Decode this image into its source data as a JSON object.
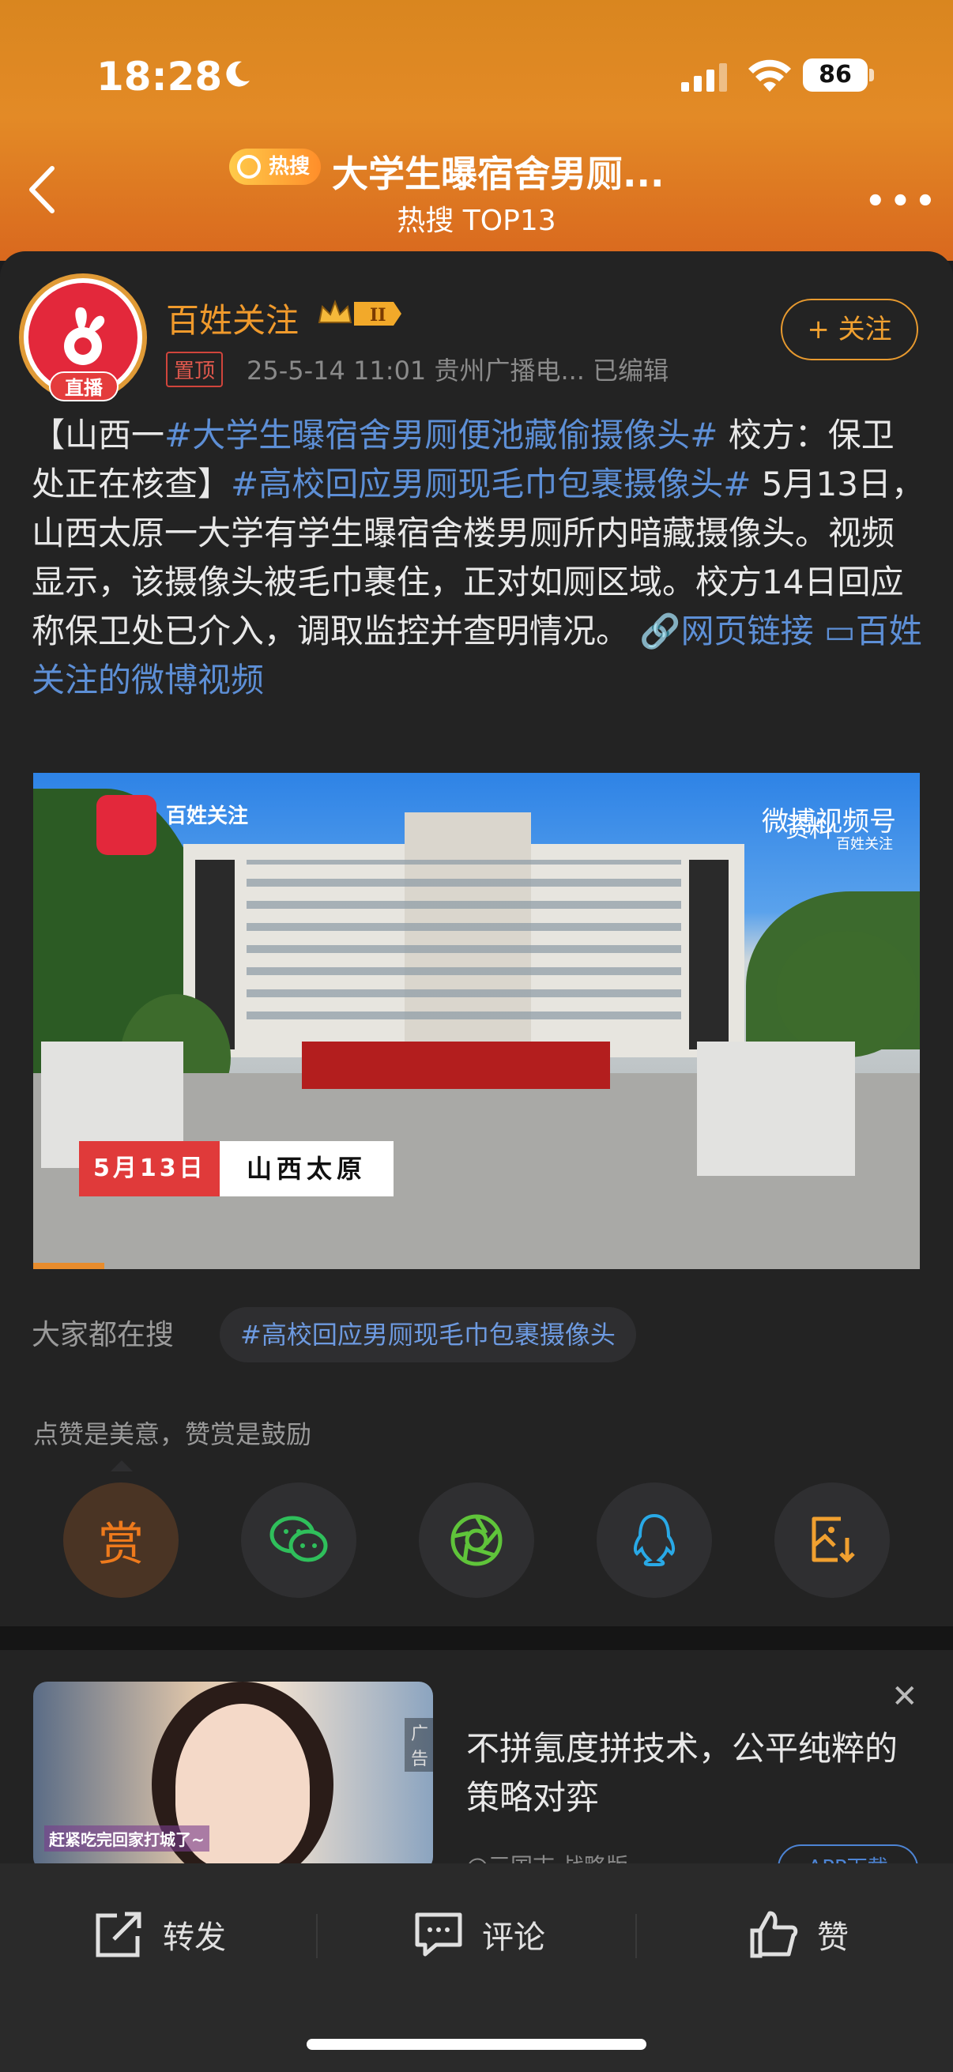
{
  "status_bar": {
    "time": "18:28",
    "battery": "86"
  },
  "header": {
    "hot_badge": "热搜",
    "title": "大学生曝宿舍男厕...",
    "subtitle": "热搜 TOP13"
  },
  "post": {
    "username": "百姓关注",
    "level_badge": "II",
    "live_label": "直播",
    "pinned_label": "置顶",
    "meta": "25-5-14 11:01  贵州广播电...  已编辑",
    "follow_label": "+ 关注",
    "body": {
      "part1": "【山西一",
      "tag1": "#大学生曝宿舍男厕便池藏偷摄像头#",
      "part2": " 校方：保卫处正在核查】",
      "tag2": "#高校回应男厕现毛巾包裹摄像头#",
      "part3": " 5月13日，山西太原一大学有学生曝宿舍楼男厕所内暗藏摄像头。视频显示，该摄像头被毛巾裹住，正对如厕区域。校方14日回应称保卫处已介入，调取监控并查明情况。",
      "link1": "网页链接",
      "link2": "百姓关注的微博视频"
    },
    "video": {
      "logo_text": "百姓关注",
      "watermark": "微博视频号",
      "watermark_sub": "百姓关注",
      "overlay_note": "资料",
      "date_tag": "5月13日",
      "place_tag": "山西太原",
      "progress_fraction": 0.08
    }
  },
  "trending": {
    "label": "大家都在搜",
    "chip": "#高校回应男厕现毛巾包裹摄像头"
  },
  "reward_note": "点赞是美意，赞赏是鼓励",
  "share_buttons": [
    {
      "name": "reward-button",
      "label": "赏",
      "icon": "reward-icon"
    },
    {
      "name": "wechat-button",
      "icon": "wechat-icon"
    },
    {
      "name": "moments-button",
      "icon": "moments-icon"
    },
    {
      "name": "qq-button",
      "icon": "qq-icon"
    },
    {
      "name": "save-image-button",
      "icon": "save-image-icon"
    }
  ],
  "ad": {
    "tag": "广告",
    "caption": "赶紧吃完回家打城了~",
    "title": "不拼氪度拼技术，公平纯粹的策略对弈",
    "source": "@三国志·战略版",
    "download": "APP下载"
  },
  "bottom_bar": {
    "repost": "转发",
    "comment": "评论",
    "like": "赞"
  },
  "colors": {
    "accent_orange": "#f09a2c",
    "link_blue": "#5d8fd6",
    "background": "#232323"
  }
}
